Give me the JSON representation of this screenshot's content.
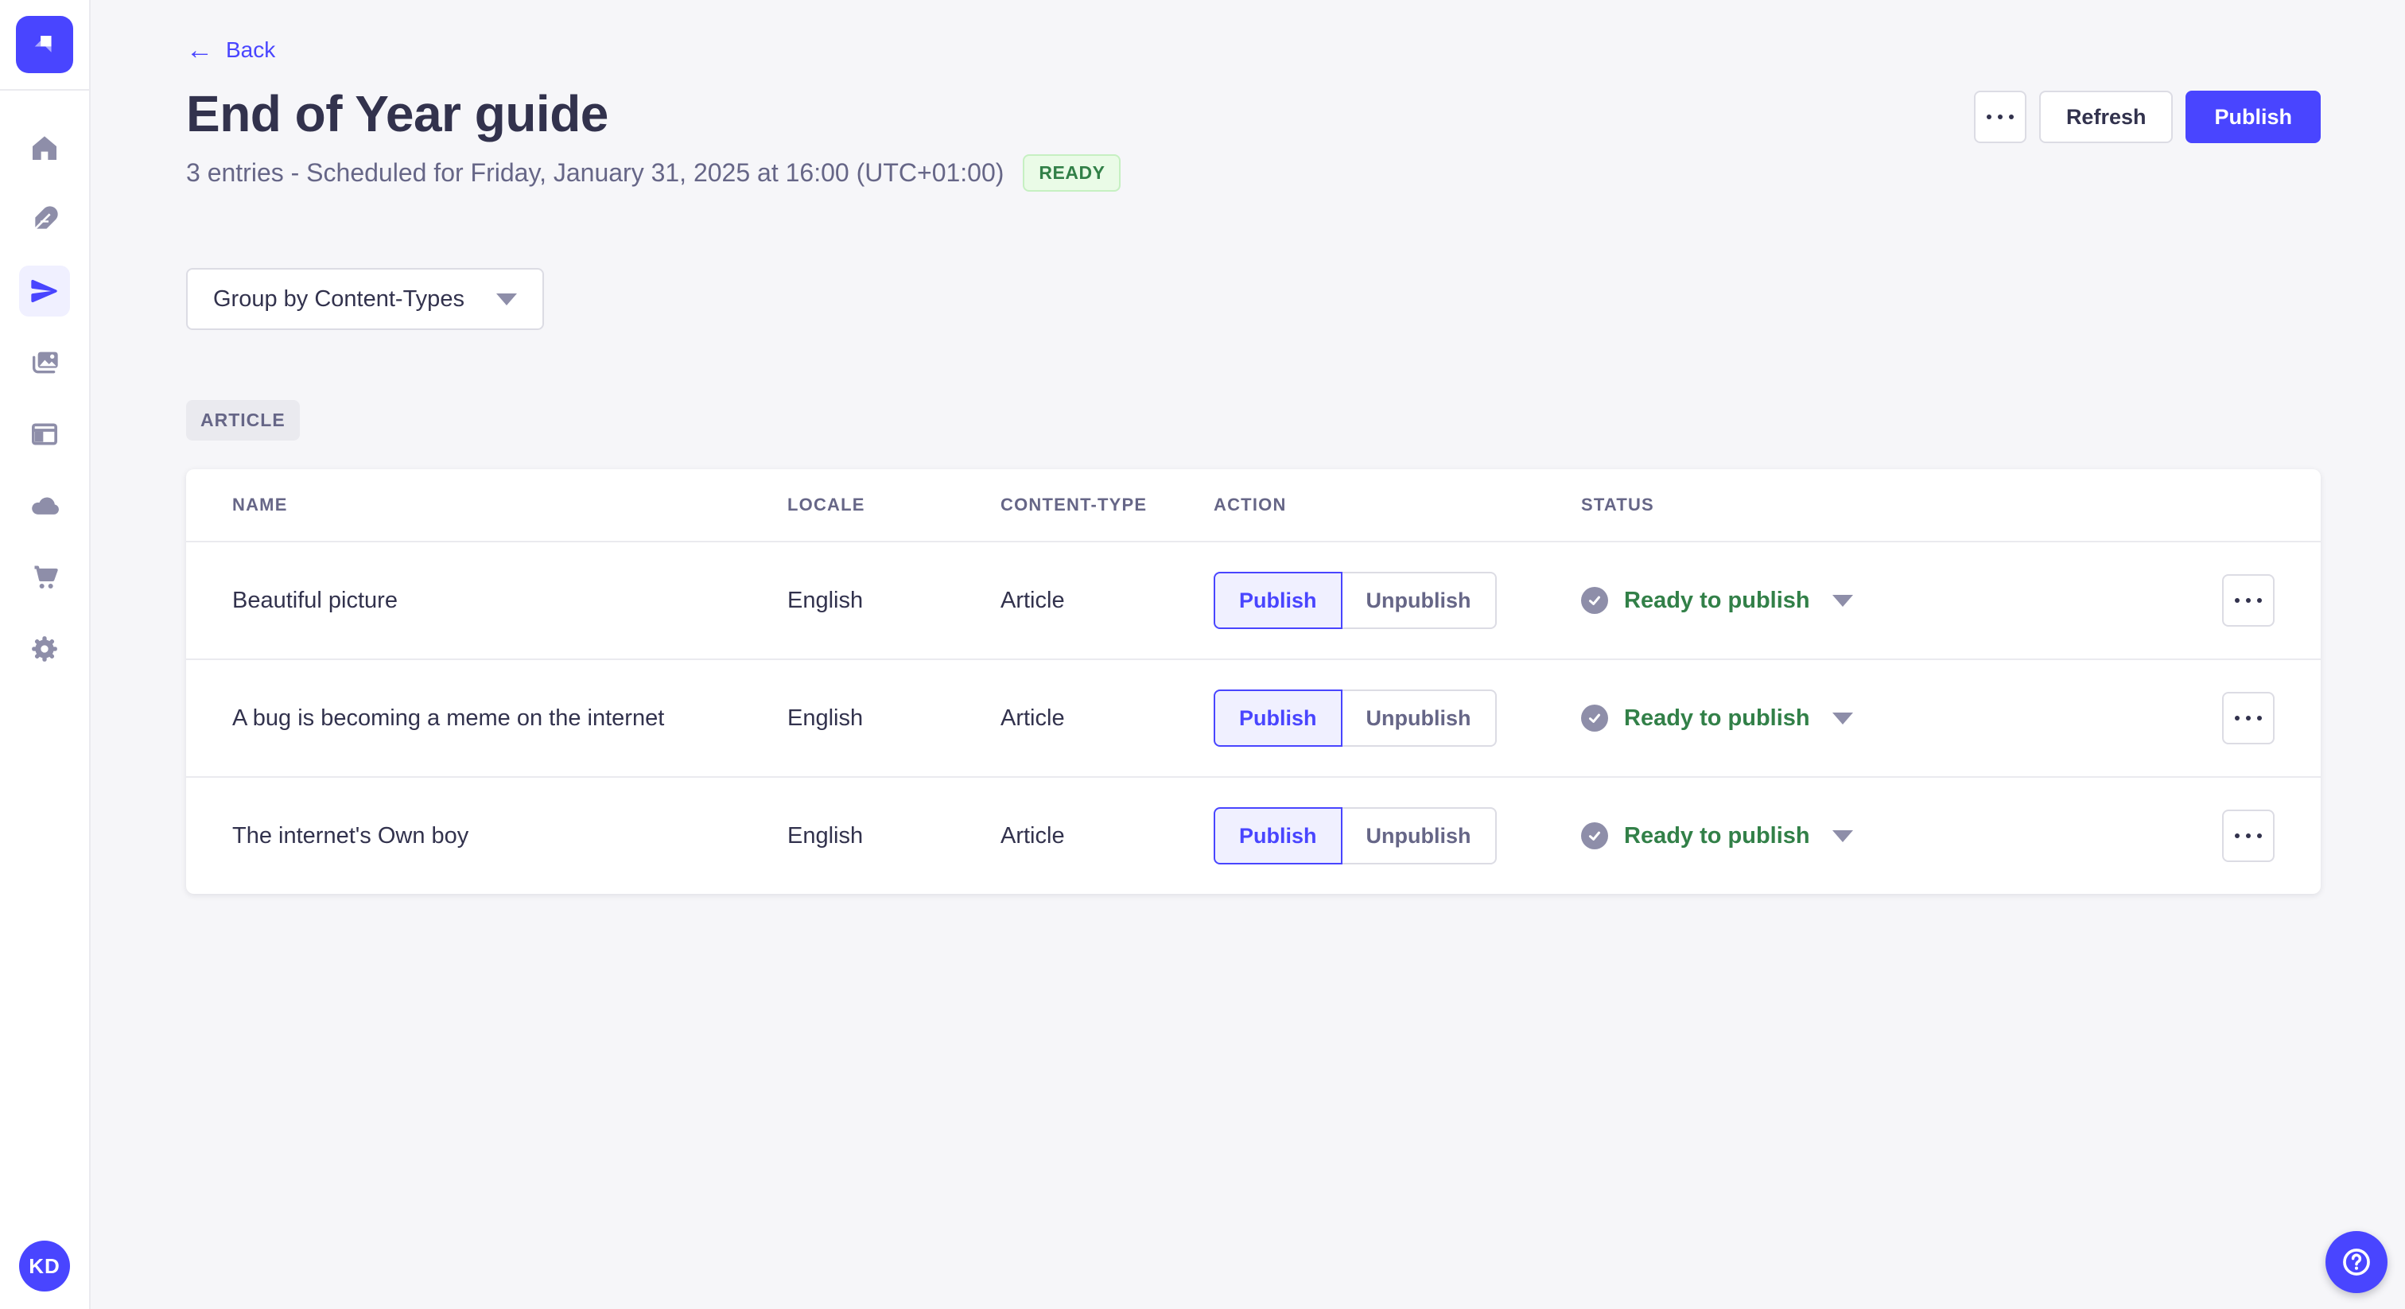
{
  "colors": {
    "primary": "#4945FF",
    "primary_light": "#F0F0FF",
    "success_text": "#328048",
    "success_bg": "#EAFBE7",
    "success_border": "#C6F0C2",
    "text_dark": "#32324D",
    "text_muted": "#666687",
    "icon_gray": "#8E8EA9",
    "border": "#DCDCE4",
    "divider": "#EAEAEF",
    "page_bg": "#F6F6F9"
  },
  "sidebar": {
    "avatar_initials": "KD",
    "items": [
      {
        "id": "home",
        "icon": "home-icon",
        "active": false
      },
      {
        "id": "content-manager",
        "icon": "feather-icon",
        "active": false
      },
      {
        "id": "releases",
        "icon": "paper-plane-icon",
        "active": true
      },
      {
        "id": "media-library",
        "icon": "images-icon",
        "active": false
      },
      {
        "id": "content-type-builder",
        "icon": "layout-icon",
        "active": false
      },
      {
        "id": "deploy",
        "icon": "cloud-icon",
        "active": false
      },
      {
        "id": "marketplace",
        "icon": "cart-icon",
        "active": false
      },
      {
        "id": "settings",
        "icon": "gear-icon",
        "active": false
      }
    ]
  },
  "header": {
    "back_label": "Back",
    "back_arrow": "←",
    "title": "End of Year guide",
    "subtitle": "3 entries - Scheduled for Friday, January 31, 2025 at 16:00 (UTC+01:00)",
    "ready_badge": "READY",
    "refresh_label": "Refresh",
    "publish_label": "Publish",
    "more_icon": "ellipsis-icon"
  },
  "toolbar": {
    "group_by_value": "Group by Content-Types",
    "caret_icon": "chevron-down-icon"
  },
  "group_badge_label": "ARTICLE",
  "table": {
    "headers": [
      "NAME",
      "LOCALE",
      "CONTENT-TYPE",
      "ACTION",
      "STATUS"
    ],
    "publish_label": "Publish",
    "unpublish_label": "Unpublish",
    "rows": [
      {
        "name": "Beautiful picture",
        "locale": "English",
        "content_type": "Article",
        "status": "Ready to publish"
      },
      {
        "name": "A bug is becoming a meme on the internet",
        "locale": "English",
        "content_type": "Article",
        "status": "Ready to publish"
      },
      {
        "name": "The internet's Own boy",
        "locale": "English",
        "content_type": "Article",
        "status": "Ready to publish"
      }
    ]
  },
  "help": {
    "icon": "question-mark-icon"
  }
}
